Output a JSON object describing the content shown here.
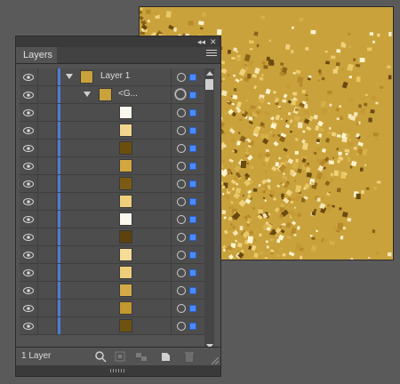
{
  "panel": {
    "tab_label": "Layers",
    "collapse_icon": "double-chevron-icon",
    "close_icon": "close-icon",
    "menu_icon": "panel-menu-icon"
  },
  "layers": {
    "layer_name": "Layer 1",
    "group_name": "<G...",
    "item_colors": [
      "#fbf8ee",
      "#f3d68e",
      "#6a4e0d",
      "#d3a63f",
      "#7a5a14",
      "#f0cf7b",
      "#fbf8ee",
      "#5c420c",
      "#f6dc98",
      "#efcd7a",
      "#d4aa48",
      "#c3982e",
      "#6e520f"
    ]
  },
  "footer": {
    "count_label": "1 Layer"
  },
  "colors": {
    "layer_color": "#4f7cd4",
    "selection": "#4a8bff",
    "gold": "#c9a23c"
  }
}
